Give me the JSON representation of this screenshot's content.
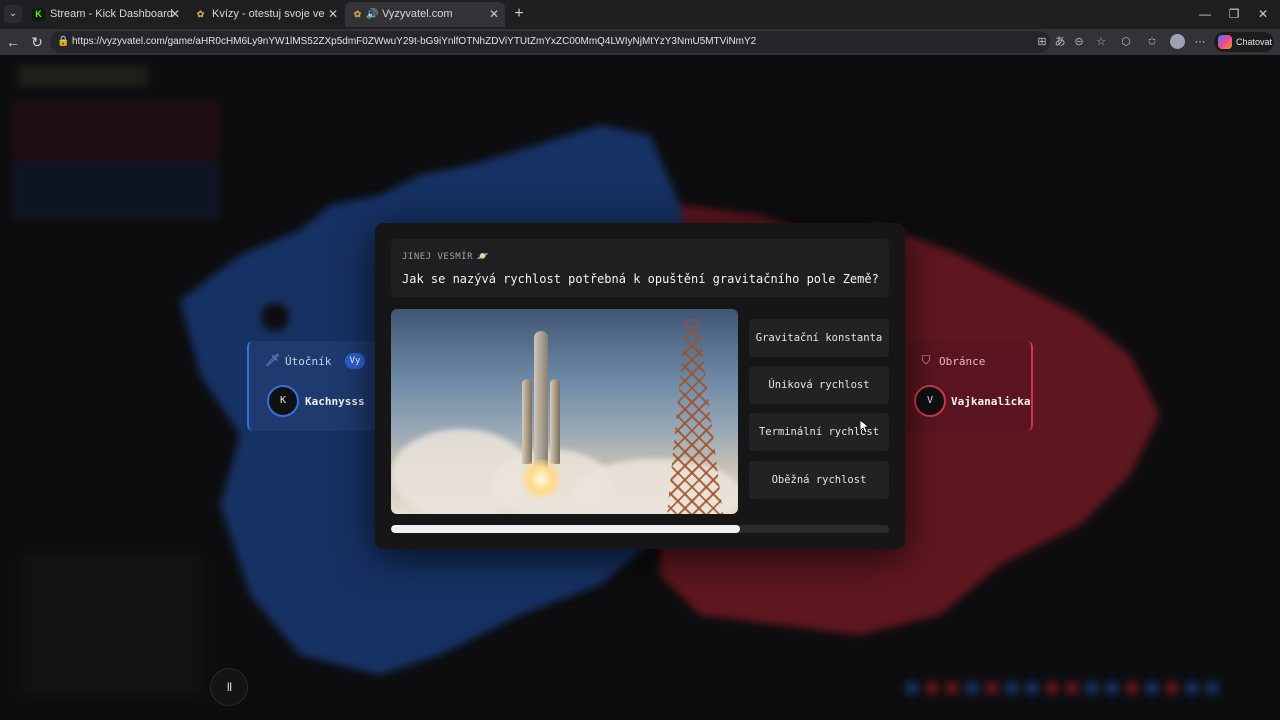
{
  "browser": {
    "tabs": [
      {
        "title": "Stream - Kick Dashboard",
        "favicon": "K",
        "favicon_color": "#53fc18",
        "active": false
      },
      {
        "title": "Kvízy - otestuj svoje vedomosti - I",
        "favicon": "✿",
        "favicon_color": "#c8a34a",
        "active": false
      },
      {
        "title": "Vyzyvatel.com",
        "favicon": "✿",
        "favicon_color": "#c8a34a",
        "active": true
      }
    ],
    "url": "https://vyzyvatel.com/game/aHR0cHM6Ly9nYW1lMS52ZXp5dmF0ZWwuY29t-bG9iYnlfOTNhZDViYTUtZmYxZC00MmQ4LWIyNjMtYzY3NmU5MTViNmY2",
    "copilot_label": "Chatovat"
  },
  "players": {
    "attacker": {
      "role": "Útočník",
      "badge": "Vy",
      "initial": "K",
      "name": "Kachnysss",
      "color": "#3b6fd8"
    },
    "defender": {
      "role": "Obránce",
      "initial": "V",
      "name": "Vajkanalicka",
      "color": "#d0374a"
    }
  },
  "quiz": {
    "category": "JINEJ VESMÍR",
    "question": "Jak se nazývá rychlost potřebná k opuštění gravitačního pole Země?",
    "answers": [
      "Gravitační konstanta",
      "Úniková rychlost",
      "Terminální rychlost",
      "Oběžná rychlost"
    ],
    "time_remaining_fraction": 0.7
  },
  "controls": {
    "pause_label": "II"
  },
  "map_colors": {
    "attacker": "#1e4fa8",
    "defender": "#a3202e"
  }
}
